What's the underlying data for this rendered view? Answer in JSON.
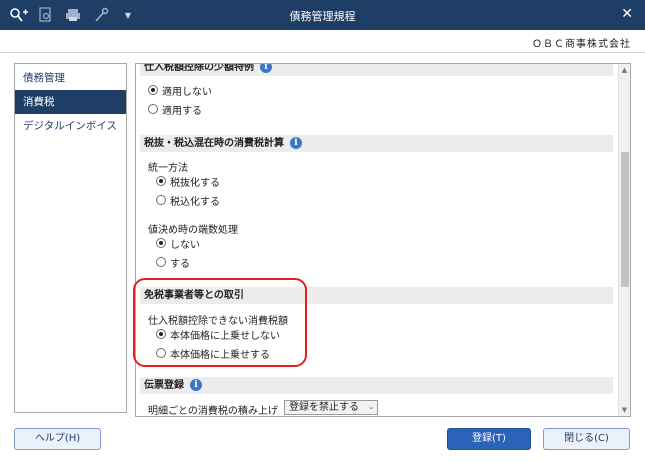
{
  "window": {
    "title": "債務管理規程"
  },
  "toolbar": {
    "icons": [
      "search-plus-icon",
      "page-search-icon",
      "printer-icon",
      "wrench-icon",
      "dropdown-arrow-icon"
    ],
    "close_glyph": "✕"
  },
  "company": "ＯＢＣ商事株式会社",
  "sidebar": {
    "items": [
      {
        "label": "債務管理",
        "active": false
      },
      {
        "label": "消費税",
        "active": true
      },
      {
        "label": "デジタルインボイス",
        "active": false
      }
    ]
  },
  "sections": {
    "special": {
      "title": "仕入税額控除の少額特例",
      "options": [
        "適用しない",
        "適用する"
      ],
      "selected": 0
    },
    "mixed": {
      "title": "税抜・税込混在時の消費税計算",
      "unify_label": "統一方法",
      "unify_options": [
        "税抜化する",
        "税込化する"
      ],
      "unify_selected": 0,
      "rounding_label": "値決め時の端数処理",
      "rounding_options": [
        "しない",
        "する"
      ],
      "rounding_selected": 0
    },
    "exempt": {
      "title": "免税事業者等との取引",
      "sub_label": "仕入税額控除できない消費税額",
      "options": [
        "本体価格に上乗せしない",
        "本体価格に上乗せする"
      ],
      "selected": 0
    },
    "voucher": {
      "title": "伝票登録",
      "row_label": "明細ごとの消費税の積み上げ",
      "select_value": "登録を禁止する"
    }
  },
  "buttons": {
    "help": "ヘルプ(H)",
    "register": "登録(T)",
    "close": "閉じる(C)"
  },
  "colors": {
    "titlebar": "#1f3e66",
    "accent": "#2b63b8",
    "highlight": "#e02020"
  }
}
